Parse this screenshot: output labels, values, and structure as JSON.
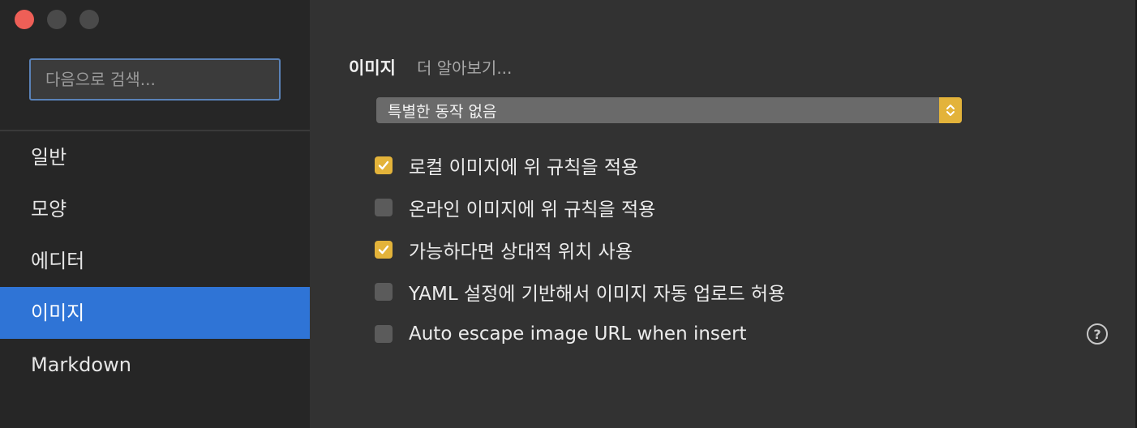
{
  "sidebar": {
    "search_placeholder": "다음으로 검색...",
    "items": [
      {
        "label": "일반",
        "active": false
      },
      {
        "label": "모양",
        "active": false
      },
      {
        "label": "에디터",
        "active": false
      },
      {
        "label": "이미지",
        "active": true
      },
      {
        "label": "Markdown",
        "active": false
      }
    ]
  },
  "main": {
    "section_title": "이미지",
    "learn_more": "더 알아보기...",
    "select_value": "특별한 동작 없음",
    "options": [
      {
        "label": "로컬 이미지에 위 규칙을 적용",
        "checked": true
      },
      {
        "label": "온라인 이미지에 위 규칙을 적용",
        "checked": false
      },
      {
        "label": "가능하다면 상대적 위치 사용",
        "checked": true
      },
      {
        "label": "YAML 설정에 기반해서 이미지 자동 업로드 허용",
        "checked": false
      },
      {
        "label": "Auto escape image URL when insert",
        "checked": false
      }
    ],
    "help_glyph": "?"
  },
  "colors": {
    "accent_blue": "#2f74d6",
    "checkbox_checked": "#e3b33a",
    "close_red": "#ee5f57"
  }
}
